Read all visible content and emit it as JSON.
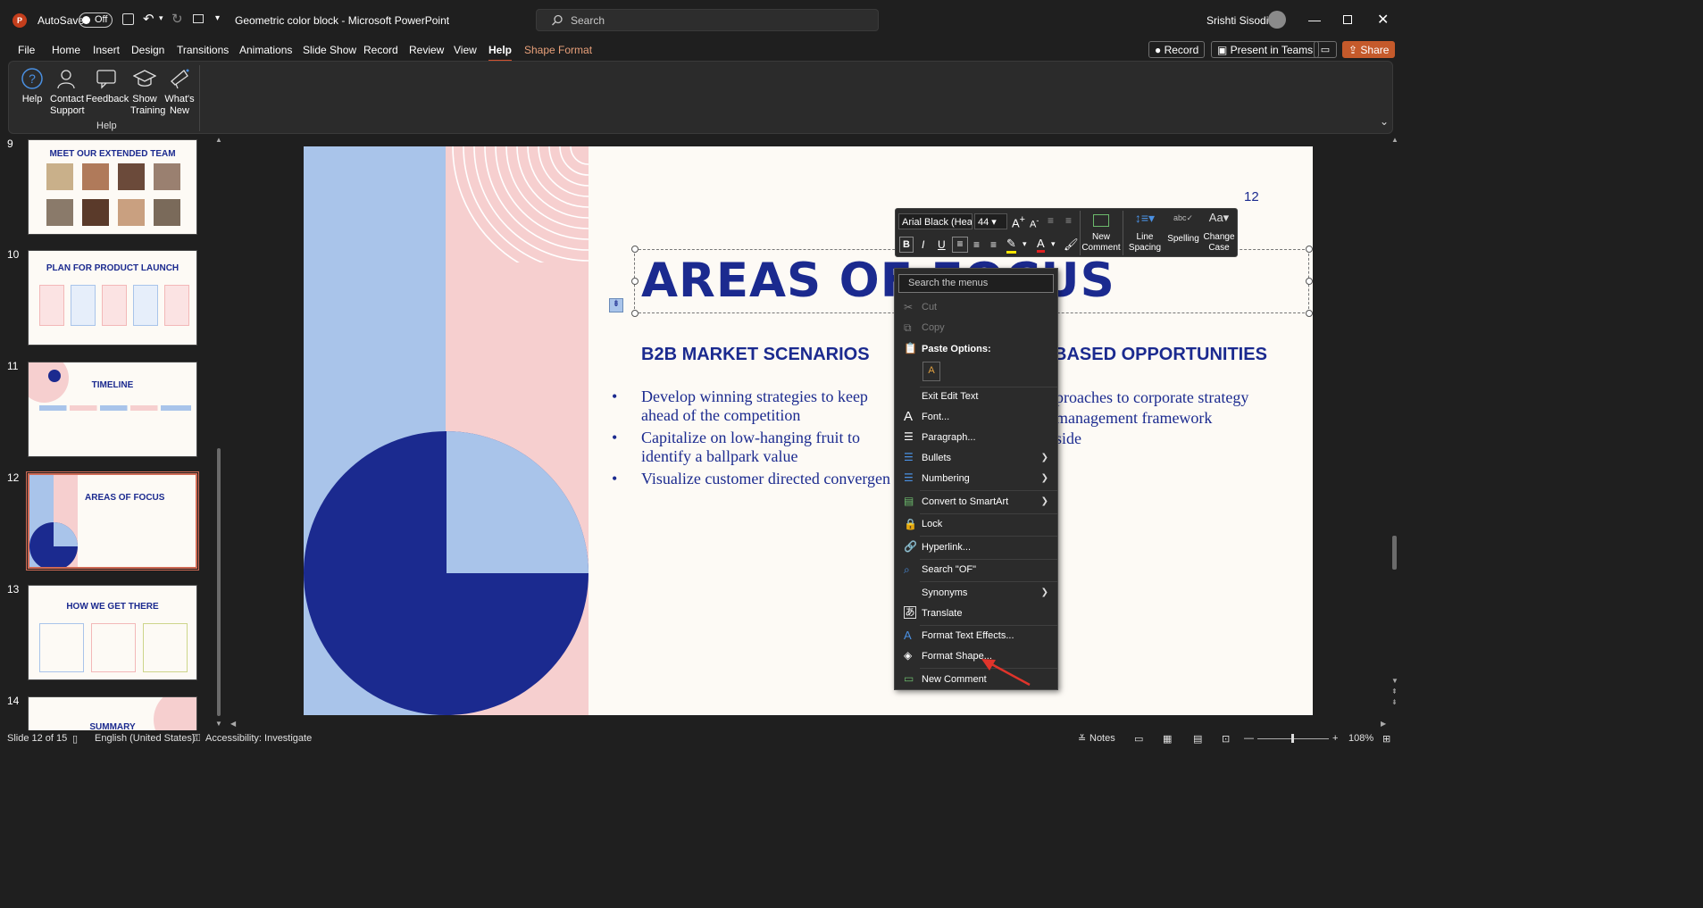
{
  "titlebar": {
    "autosave_label": "AutoSave",
    "autosave_state": "Off",
    "doc_title": "Geometric color block  -  Microsoft PowerPoint",
    "search_placeholder": "Search",
    "user_name": "Srishti Sisodia"
  },
  "tabs": [
    "File",
    "Home",
    "Insert",
    "Design",
    "Transitions",
    "Animations",
    "Slide Show",
    "Record",
    "Review",
    "View",
    "Help",
    "Shape Format"
  ],
  "right_buttons": {
    "record": "Record",
    "present": "Present in Teams",
    "share": "Share"
  },
  "ribbon": {
    "items": [
      {
        "label1": "Help",
        "label2": "",
        "icon": "help-icon"
      },
      {
        "label1": "Contact",
        "label2": "Support",
        "icon": "person-icon"
      },
      {
        "label1": "Feedback",
        "label2": "",
        "icon": "feedback-icon"
      },
      {
        "label1": "Show",
        "label2": "Training",
        "icon": "graduation-cap-icon"
      },
      {
        "label1": "What's",
        "label2": "New",
        "icon": "megaphone-icon"
      }
    ],
    "group_label": "Help"
  },
  "thumbnails": [
    {
      "num": "9",
      "title": "MEET OUR EXTENDED TEAM"
    },
    {
      "num": "10",
      "title": "PLAN FOR PRODUCT LAUNCH"
    },
    {
      "num": "11",
      "title": "TIMELINE"
    },
    {
      "num": "12",
      "title": "AREAS OF FOCUS"
    },
    {
      "num": "13",
      "title": "HOW WE GET THERE"
    },
    {
      "num": "14",
      "title": "SUMMARY"
    }
  ],
  "slide": {
    "page_number": "12",
    "title": "AREAS OF FOCUS",
    "heading_left": "B2B MARKET SCENARIOS",
    "heading_right": "BASED OPPORTUNITIES",
    "bullets_left": [
      [
        "Develop winning strategies to keep",
        "ahead of the competition"
      ],
      [
        "Capitalize on low-hanging fruit to",
        "identify a ballpark value"
      ],
      [
        "Visualize customer directed convergen"
      ]
    ],
    "bullets_right": [
      "proaches to corporate strategy",
      "management framework",
      "side"
    ]
  },
  "mini_toolbar": {
    "font_name": "Arial Black (Hea",
    "font_size": "44",
    "new_comment": [
      "New",
      "Comment"
    ],
    "line_spacing": [
      "Line",
      "Spacing"
    ],
    "spelling": "Spelling",
    "change_case": [
      "Change",
      "Case"
    ]
  },
  "context_menu": {
    "search_placeholder": "Search the menus",
    "cut": "Cut",
    "copy": "Copy",
    "paste_options": "Paste Options:",
    "exit_edit": "Exit Edit Text",
    "font": "Font...",
    "paragraph": "Paragraph...",
    "bullets": "Bullets",
    "numbering": "Numbering",
    "smartart": "Convert to SmartArt",
    "lock": "Lock",
    "hyperlink": "Hyperlink...",
    "search_of": "Search \"OF\"",
    "synonyms": "Synonyms",
    "translate": "Translate",
    "text_effects": "Format Text Effects...",
    "format_shape": "Format Shape...",
    "new_comment": "New Comment"
  },
  "statusbar": {
    "slide_info": "Slide 12 of 15",
    "language": "English (United States)",
    "accessibility": "Accessibility: Investigate",
    "notes": "Notes",
    "zoom": "108%"
  },
  "colors": {
    "navy": "#1b2a8f",
    "light_blue": "#a9c4ea",
    "pink": "#f6cfcf",
    "accent": "#d35230"
  }
}
